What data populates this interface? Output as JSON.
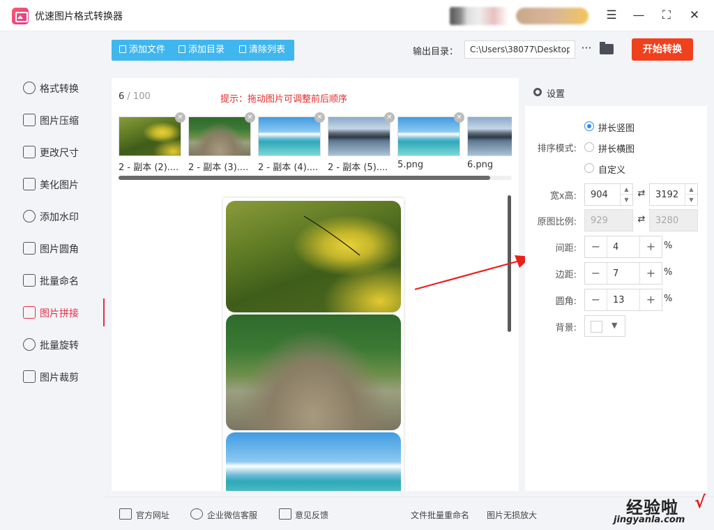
{
  "app": {
    "title": "优速图片格式转换器"
  },
  "window_controls": {
    "menu": "☰",
    "minimize": "—",
    "maximize": "⛶",
    "close": "✕"
  },
  "sidebar": {
    "items": [
      {
        "label": "格式转换",
        "icon": "format-convert-icon"
      },
      {
        "label": "图片压缩",
        "icon": "compress-icon"
      },
      {
        "label": "更改尺寸",
        "icon": "resize-icon"
      },
      {
        "label": "美化图片",
        "icon": "beautify-icon"
      },
      {
        "label": "添加水印",
        "icon": "watermark-icon"
      },
      {
        "label": "图片圆角",
        "icon": "round-corner-icon"
      },
      {
        "label": "批量命名",
        "icon": "rename-icon"
      },
      {
        "label": "图片拼接",
        "icon": "stitch-icon",
        "active": true
      },
      {
        "label": "批量旋转",
        "icon": "rotate-icon"
      },
      {
        "label": "图片裁剪",
        "icon": "crop-icon"
      }
    ]
  },
  "toolbar": {
    "add_file": "添加文件",
    "add_dir": "添加目录",
    "clear_list": "清除列表",
    "output_label": "输出目录：",
    "output_path": "C:\\Users\\38077\\Desktop",
    "more": "···",
    "start": "开始转换"
  },
  "list": {
    "count": "6",
    "total": "/ 100",
    "hint": "提示：拖动图片可调整前后顺序",
    "thumbs": [
      {
        "label": "2 - 副本 (2)....",
        "image": "flower"
      },
      {
        "label": "2 - 副本 (3)....",
        "image": "forest"
      },
      {
        "label": "2 - 副本 (4)....",
        "image": "beach"
      },
      {
        "label": "2 - 副本 (5)....",
        "image": "lake"
      },
      {
        "label": "5.png",
        "image": "beach"
      },
      {
        "label": "6.png",
        "image": "lake"
      }
    ],
    "remove_icon": "✕"
  },
  "settings": {
    "title": "设置",
    "sort_label": "排序模式:",
    "sort_options": [
      "拼长竖图",
      "拼长横图",
      "自定义"
    ],
    "sort_selected": 0,
    "size_label": "宽x高:",
    "width": "904",
    "height": "3192",
    "ratio_label": "原图比例:",
    "ratio_w": "929",
    "ratio_h": "3280",
    "spacing_label": "间距:",
    "spacing": "4",
    "margin_label": "边距:",
    "margin": "7",
    "radius_label": "圆角:",
    "radius": "13",
    "unit": "%",
    "bg_label": "背景:",
    "bg_color": "#ffffff"
  },
  "footer": {
    "site": "官方网址",
    "wechat": "企业微信客服",
    "feedback": "意见反馈",
    "batch_rename": "文件批量重命名",
    "lossless": "图片无损放大"
  },
  "watermark": {
    "cn": "经验啦",
    "check": "√",
    "en": "jingyanla.com"
  },
  "colors": {
    "accent": "#e0304a",
    "primary_blue": "#3fb6ee",
    "start": "#f0411e",
    "hint": "#e52b2b",
    "arrow": "#e8221b"
  }
}
